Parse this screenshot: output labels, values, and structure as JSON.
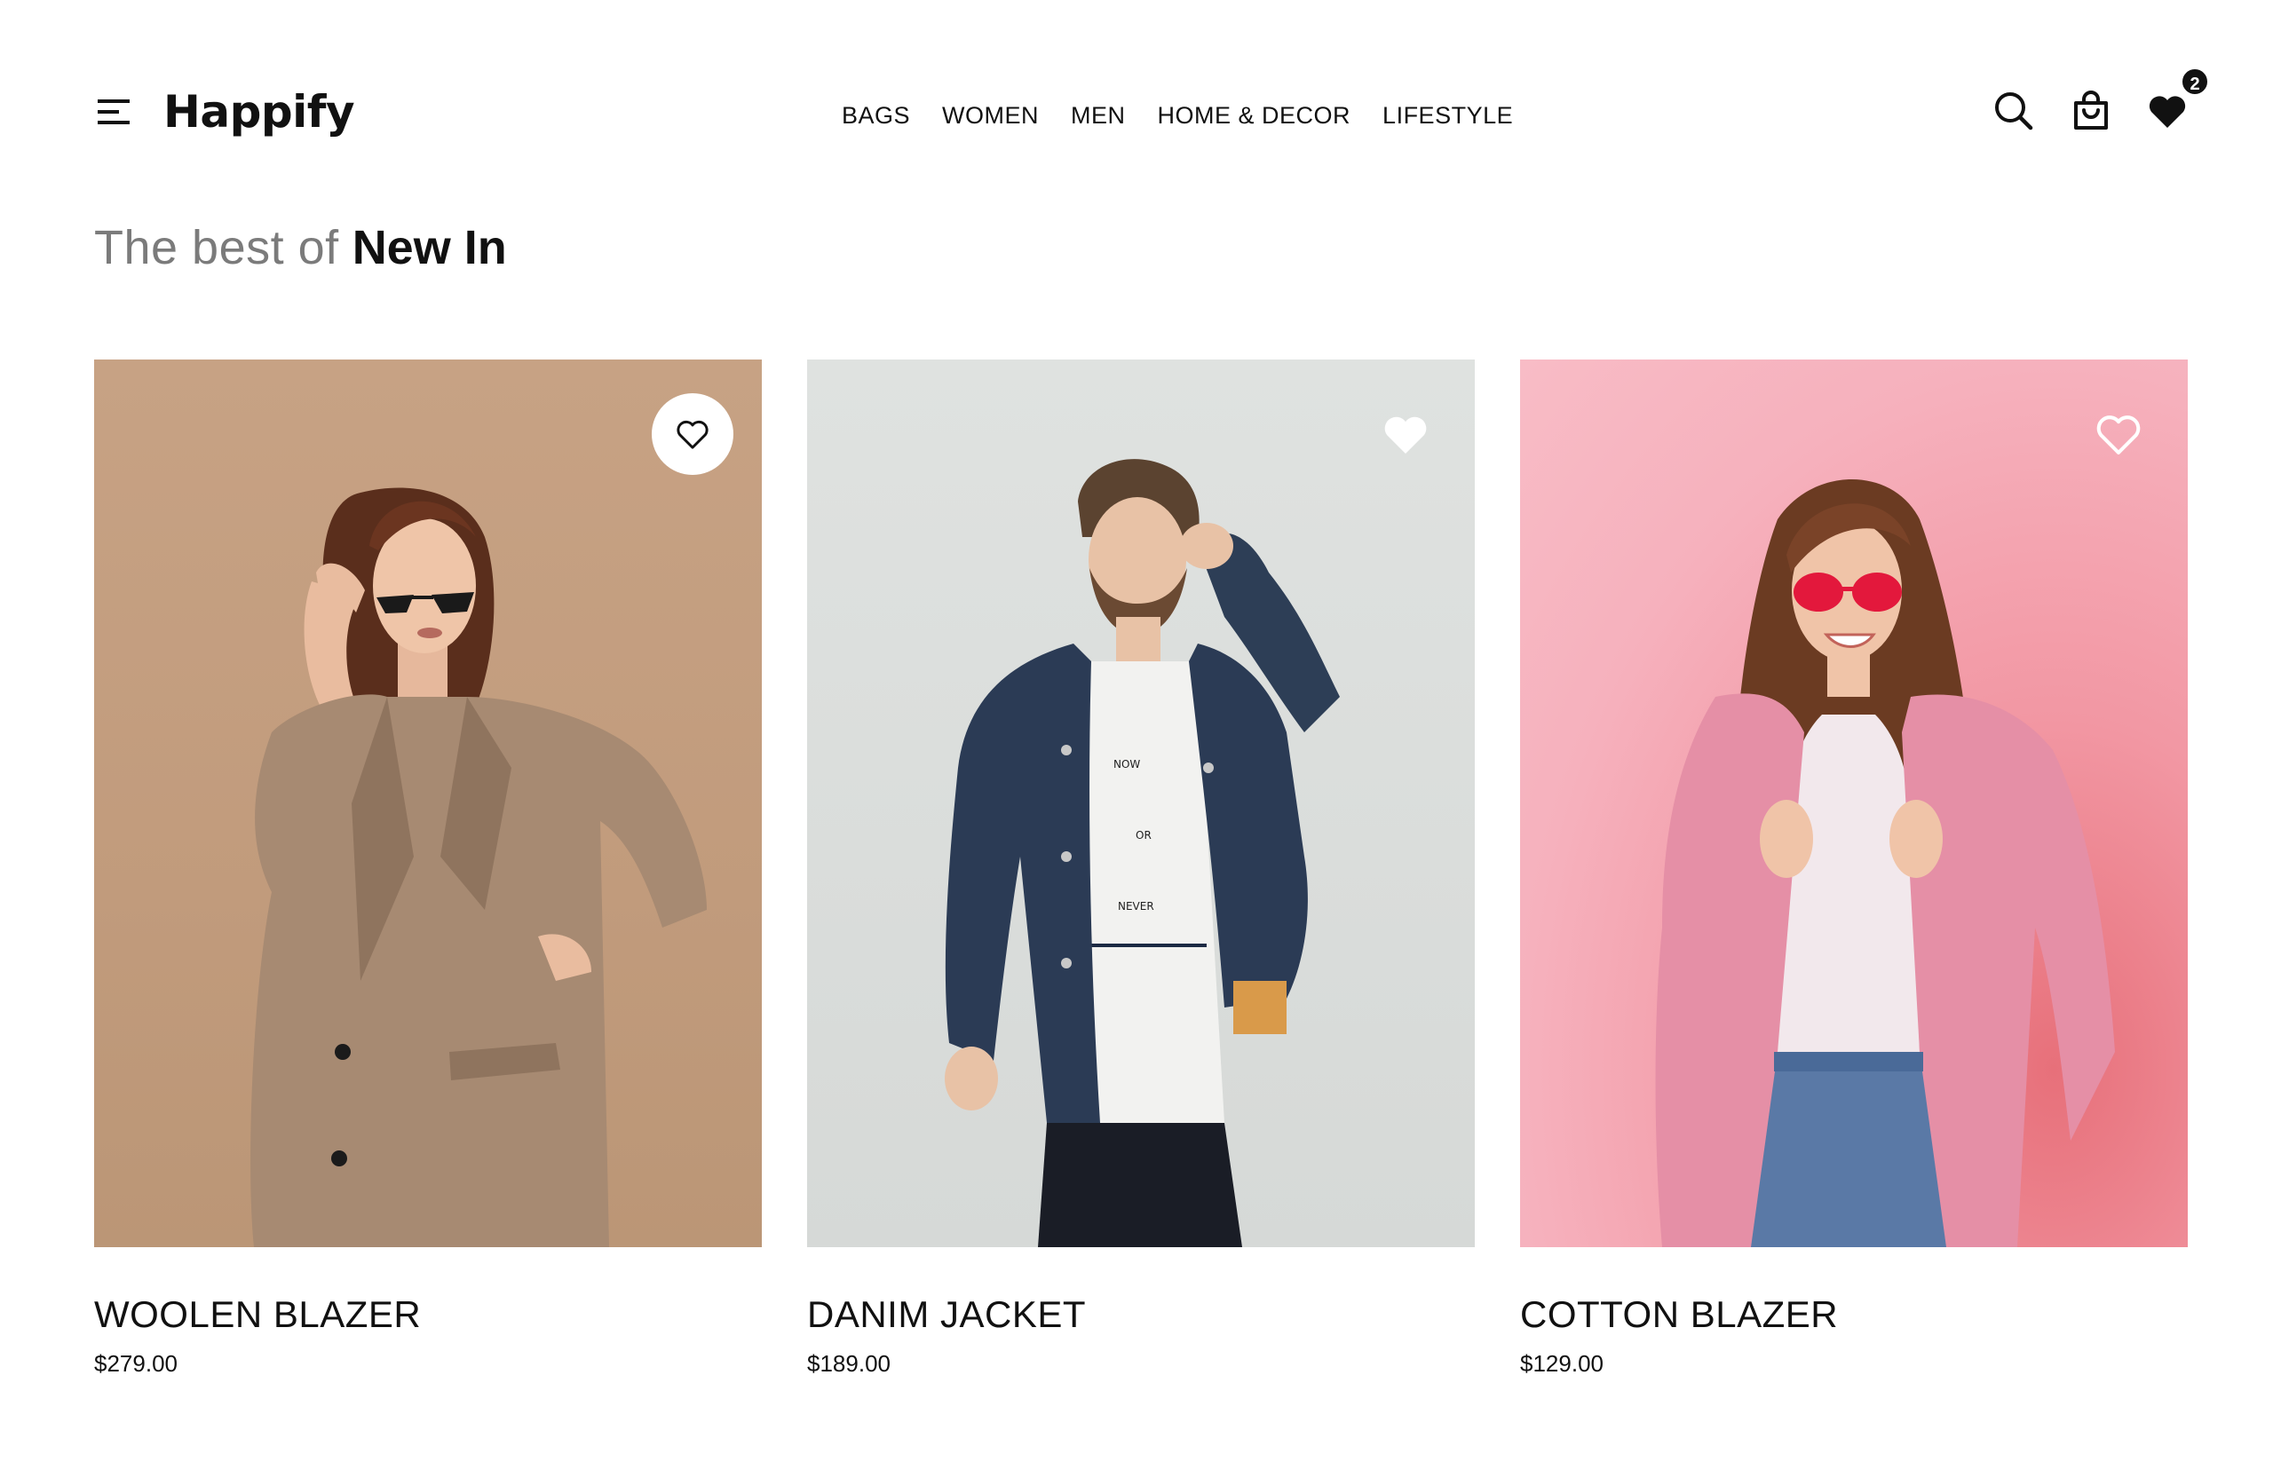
{
  "header": {
    "brand": "Happify",
    "menu_icon": "hamburger-menu-icon",
    "nav": [
      {
        "label": "BAGS"
      },
      {
        "label": "WOMEN"
      },
      {
        "label": "MEN"
      },
      {
        "label": "HOME & DECOR"
      },
      {
        "label": "LIFESTYLE"
      }
    ],
    "icons": {
      "search": "search-icon",
      "bag": "shopping-bag-icon",
      "wishlist": "heart-icon"
    },
    "wishlist_count": "2"
  },
  "section": {
    "title_light": "The best of",
    "title_strong": "New In"
  },
  "products": [
    {
      "name": "WOOLEN BLAZER",
      "price": "$279.00",
      "favorite_style": "outline-on-white-circle",
      "image": "woman-in-beige-blazer-with-sunglasses"
    },
    {
      "name": "DANIM JACKET",
      "price": "$189.00",
      "favorite_style": "filled-white",
      "image": "man-in-denim-jacket",
      "shirt_text": [
        "NOW",
        "OR",
        "NEVER"
      ]
    },
    {
      "name": "COTTON BLAZER",
      "price": "$129.00",
      "favorite_style": "outline-white",
      "image": "woman-in-pink-blazer-with-red-sunglasses"
    }
  ],
  "colors": {
    "text": "#111111",
    "muted": "#7b7b7b",
    "card1_bg": "#c19b7c",
    "card2_bg": "#d9dcda",
    "card3_bg": "#f6b1bd"
  }
}
